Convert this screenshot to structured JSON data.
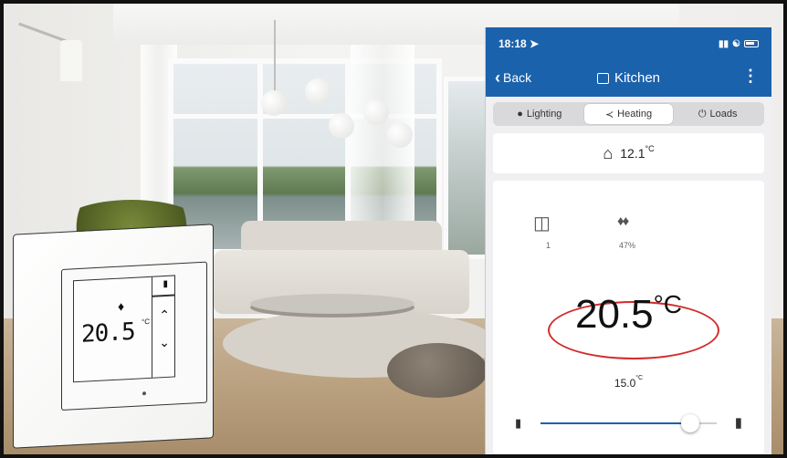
{
  "statusbar": {
    "time": "18:18",
    "location_icon": "location-arrow-icon",
    "signal_icon": "signal-icon",
    "wifi_icon": "wifi-icon",
    "battery_icon": "battery-icon"
  },
  "nav": {
    "back_label": "Back",
    "title": "Kitchen",
    "menu_icon": "kebab-menu-icon"
  },
  "tabs": [
    {
      "label": "Lighting",
      "icon": "bulb-icon",
      "active": false
    },
    {
      "label": "Heating",
      "icon": "thermometer-icon",
      "active": true
    },
    {
      "label": "Loads",
      "icon": "power-icon",
      "active": false
    }
  ],
  "outdoor": {
    "value": "12.1",
    "unit": "°C"
  },
  "window_status": {
    "count": "1"
  },
  "humidity": {
    "value": "47%"
  },
  "setpoint": {
    "value": "20.5",
    "unit": "°C"
  },
  "min_setpoint": {
    "value": "15.0",
    "unit": "°C"
  },
  "slider": {
    "fraction": 0.85
  },
  "device": {
    "display_value": "20.5",
    "unit": "°C"
  },
  "colors": {
    "brand_blue": "#1b62ac",
    "highlight_red": "#d42a2a"
  }
}
